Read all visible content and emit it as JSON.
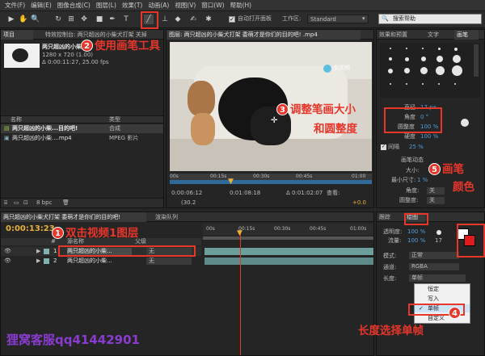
{
  "menu": [
    "文件(F)",
    "编辑(E)",
    "图像合成(C)",
    "图层(L)",
    "效果(T)",
    "动画(A)",
    "视图(V)",
    "窗口(W)",
    "帮助(H)"
  ],
  "toolbar": {
    "auto_open_checkbox": "自动打开面板",
    "workspace_label": "工作区:",
    "workspace_value": "Standard",
    "search_placeholder": "搜索帮助"
  },
  "project": {
    "tab_project": "项目",
    "tab_effects": "特效控制台: 两只超凶的小柴犬打架 关掉",
    "thumb_title": "两只超凶的小柴",
    "thumb_info_1": "1280 x 720 (1.00)",
    "thumb_info_2": "Δ 0:00:11:27, 25.00 fps",
    "col_name": "名称",
    "col_type": "类型",
    "items": [
      {
        "name": "两只超凶的小柴...目的吧!",
        "type": "合成"
      },
      {
        "name": "两只超凶的小柴....mp4",
        "type": "MPEG 影片"
      }
    ],
    "bpc": "8 bpc"
  },
  "viewer": {
    "tab_label": "图层: 两只超凶的小柴犬打架 委萌才是你们的目的吧! .mp4",
    "watermark": "宗视频",
    "ruler_marks": [
      "00s",
      "00:15s",
      "00:30s",
      "00:45s",
      "01:00"
    ],
    "tc_in": "0:00:06:12",
    "tc_out": "0:01:08:18",
    "tc_dur": "Δ 0:01:02:07",
    "view_label": "查看:",
    "zoom": "(30.2",
    "plus_value": "+0.0"
  },
  "right_panel": {
    "tab_effects_presets": "效果和预置",
    "tab_text": "文字",
    "tab_brush": "画笔",
    "diameter_label": "直径",
    "diameter_value": "17 px",
    "angle_label": "角度",
    "angle_value": "0 °",
    "roundness_label": "圆整度",
    "roundness_value": "100 %",
    "hardness_label": "硬度",
    "hardness_value": "100 %",
    "spacing_label": "间隔",
    "spacing_value": "25 %",
    "dynamics_header": "画笔动态",
    "dyn_size": "大小:",
    "dyn_min_size": "最小尺寸:",
    "dyn_min_size_value": "1 %",
    "dyn_angle": "角度:",
    "dyn_angle_value": "关",
    "dyn_roundness": "圆整度:",
    "dyn_roundness_value": "关",
    "dyn_opacity_value": "关"
  },
  "paint_panel": {
    "tab_tracker": "跟踪",
    "tab_paint": "绘图",
    "opacity_label": "透明度:",
    "opacity_value": "100 %",
    "flow_label": "流量:",
    "flow_value": "100 %",
    "mode_label": "模式:",
    "mode_value": "正常",
    "channel_label": "通道:",
    "channel_value": "RGBA",
    "duration_label": "长度:",
    "duration_value": "单帧",
    "brush_size_value": "17",
    "dropdown": [
      "恒定",
      "写入",
      "单帧",
      "自定义"
    ]
  },
  "timeline": {
    "tab_comp": "两只超凶的小柴犬打架 委萌才是你们的目的吧!",
    "tab_render": "渲染队列",
    "timecode": "0:00:13:23",
    "col_number": "#",
    "col_source": "源名称",
    "col_parent": "父级",
    "layers": [
      {
        "num": "1",
        "name": "两只超凶的小柴...",
        "parent": "无"
      },
      {
        "num": "2",
        "name": "两只超凶的小柴...",
        "parent": "无"
      }
    ],
    "ruler_marks": [
      "00s",
      "00:15s",
      "00:30s",
      "00:45s",
      "01:00s"
    ]
  },
  "annotations": {
    "a1_num": "1",
    "a1_text": "双击视频1图层",
    "a2_num": "2",
    "a2_text": "使用画笔工具",
    "a3_num": "3",
    "a3_line1": "调整笔画大小",
    "a3_line2": "和圆整度",
    "a4_num": "4",
    "a4_text": "长度选择单帧",
    "a5_num": "5",
    "a5_line1": "画笔",
    "a5_line2": "颜色"
  },
  "watermark_text": "狸窝客服qq41442901",
  "colors": {
    "accent_red": "#e8362a",
    "panel_bg": "#252525",
    "timecode_yellow": "#e8b23a",
    "watermark_purple": "#8a3bd0"
  }
}
